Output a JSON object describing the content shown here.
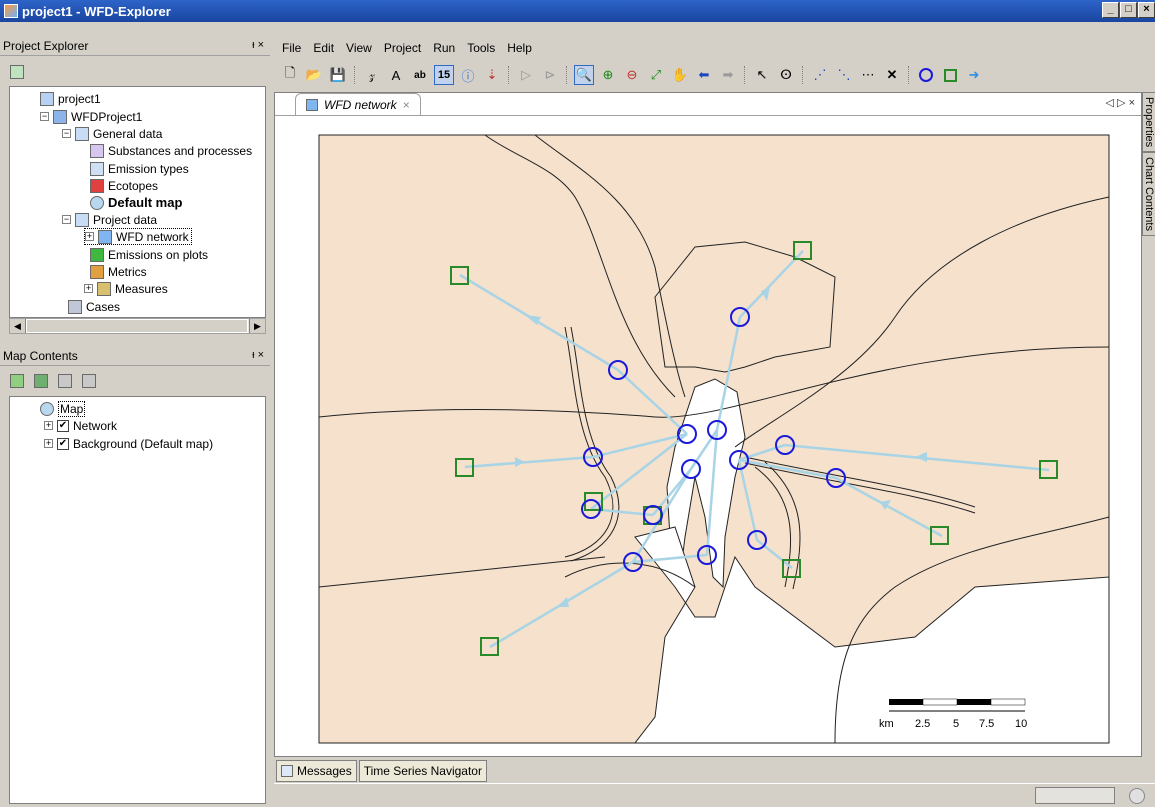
{
  "window": {
    "title": "project1 - WFD-Explorer",
    "buttons": [
      "_",
      "□",
      "×"
    ]
  },
  "project_explorer": {
    "title": "Project Explorer",
    "pin": "ᵻ ×",
    "items": [
      {
        "label": "project1"
      },
      {
        "label": "WFDProject1"
      },
      {
        "label": "General data"
      },
      {
        "label": "Substances and processes"
      },
      {
        "label": "Emission types"
      },
      {
        "label": "Ecotopes"
      },
      {
        "label": "Default map"
      },
      {
        "label": "Project data"
      },
      {
        "label": "WFD network"
      },
      {
        "label": "Emissions on plots"
      },
      {
        "label": "Metrics"
      },
      {
        "label": "Measures"
      },
      {
        "label": "Cases"
      }
    ]
  },
  "map_contents": {
    "title": "Map Contents",
    "pin": "ᵻ ×",
    "items": [
      {
        "label": "Map"
      },
      {
        "label": "Network"
      },
      {
        "label": "Background (Default map)"
      }
    ]
  },
  "menu": [
    "File",
    "Edit",
    "View",
    "Project",
    "Run",
    "Tools",
    "Help"
  ],
  "doc_tab": {
    "label": "WFD network",
    "close": "×",
    "nav": "◁ ▷ ×"
  },
  "side_tabs": [
    "Properties",
    "Chart Contents"
  ],
  "bottom_tabs": [
    "Messages",
    "Time Series Navigator"
  ],
  "toolbar_badge": "15",
  "scale_bar": {
    "unit": "km",
    "labels": [
      "2.5",
      "5",
      "7.5",
      "10"
    ]
  },
  "colors": {
    "land": "#f5e1cc",
    "link": "#a8d4e6",
    "node_circle": "#1a1adb",
    "node_square": "#2a8a2a"
  }
}
